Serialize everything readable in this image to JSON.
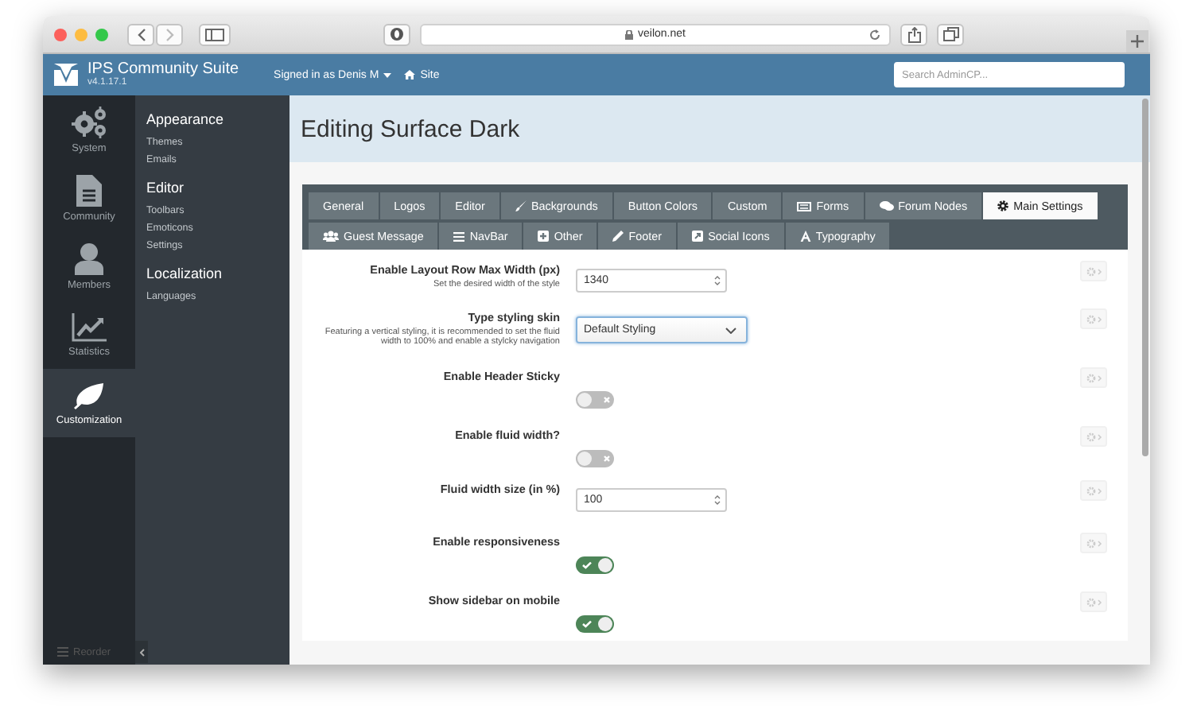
{
  "browser": {
    "url": "veilon.net"
  },
  "header": {
    "product": "IPS Community Suite",
    "version": "v4.1.17.1",
    "signed_in": "Signed in as Denis M",
    "site_link": "Site",
    "search": {
      "placeholder": "Search AdminCP..."
    }
  },
  "nav": [
    {
      "label": "System",
      "selected": false
    },
    {
      "label": "Community",
      "selected": false
    },
    {
      "label": "Members",
      "selected": false
    },
    {
      "label": "Statistics",
      "selected": false
    },
    {
      "label": "Customization",
      "selected": true
    }
  ],
  "reorder": "Reorder",
  "submenu": [
    {
      "heading": "Appearance",
      "items": [
        "Themes",
        "Emails"
      ]
    },
    {
      "heading": "Editor",
      "items": [
        "Toolbars",
        "Emoticons",
        "Settings"
      ]
    },
    {
      "heading": "Localization",
      "items": [
        "Languages"
      ]
    }
  ],
  "page_title": "Editing Surface Dark",
  "tabs": [
    {
      "label": "General",
      "selected": false
    },
    {
      "label": "Logos",
      "selected": false
    },
    {
      "label": "Editor",
      "selected": false
    },
    {
      "label": "Backgrounds",
      "selected": false
    },
    {
      "label": "Button Colors",
      "selected": false
    },
    {
      "label": "Custom",
      "selected": false
    },
    {
      "label": "Forms",
      "selected": false
    },
    {
      "label": "Forum Nodes",
      "selected": false
    },
    {
      "label": "Main Settings",
      "selected": true
    },
    {
      "label": "Guest Message",
      "selected": false
    },
    {
      "label": "NavBar",
      "selected": false
    },
    {
      "label": "Other",
      "selected": false
    },
    {
      "label": "Footer",
      "selected": false
    },
    {
      "label": "Social Icons",
      "selected": false
    },
    {
      "label": "Typography",
      "selected": false
    }
  ],
  "settings": [
    {
      "kind": "number",
      "label": "Enable Layout Row Max Width (px)",
      "description": "Set the desired width of the style",
      "value": "1340"
    },
    {
      "kind": "select",
      "label": "Type styling skin",
      "description": "Featuring a vertical styling, it is recommended to set the fluid width to 100% and enable a stylcky navigation",
      "value": "Default Styling",
      "focused": true
    },
    {
      "kind": "toggle",
      "label": "Enable Header Sticky",
      "on": false
    },
    {
      "kind": "toggle",
      "label": "Enable fluid width?",
      "on": false
    },
    {
      "kind": "number",
      "label": "Fluid width size (in %)",
      "value": "100"
    },
    {
      "kind": "toggle",
      "label": "Enable responsiveness",
      "on": true
    },
    {
      "kind": "toggle",
      "label": "Show sidebar on mobile",
      "on": true
    }
  ]
}
